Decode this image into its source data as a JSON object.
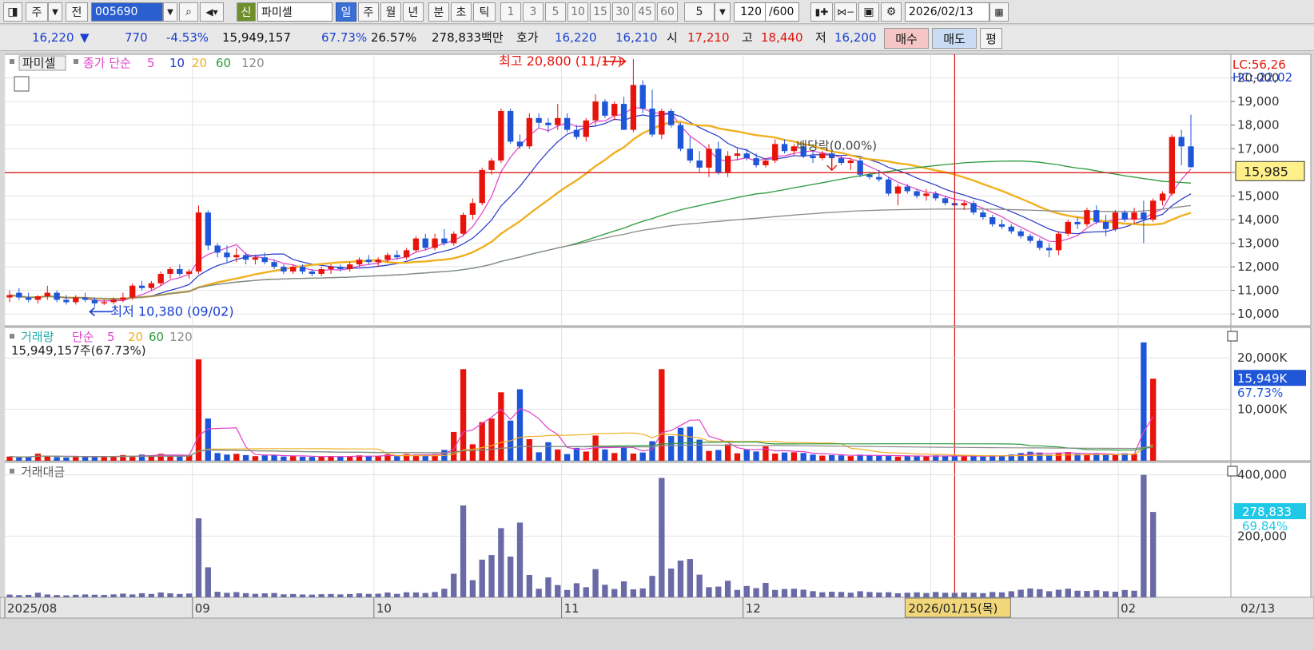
{
  "toolbar": {
    "type_label": "주",
    "prev_label": "전",
    "code": "005690",
    "stock_name": "파미셀",
    "new_label": "신",
    "periods": [
      "일",
      "주",
      "월",
      "년"
    ],
    "period_selected": "일",
    "intraday": [
      "분",
      "초",
      "틱"
    ],
    "minutes": [
      "1",
      "3",
      "5",
      "10",
      "15",
      "30",
      "45",
      "60"
    ],
    "custom_minute": "5",
    "bar_count": "120",
    "bar_total": "/600",
    "date": "2026/02/13"
  },
  "quote": {
    "price": "16,220",
    "arrow": "▼",
    "change": "770",
    "change_pct": "-4.53%",
    "volume": "15,949,157",
    "vol_ratio": "67.73%",
    "turnover_ratio": "26.57%",
    "amount": "278,833백만",
    "ask_label": "호가",
    "ask": "16,220",
    "bid": "16,210",
    "open_label": "시",
    "open": "17,210",
    "high_label": "고",
    "high": "18,440",
    "low_label": "저",
    "low": "16,200",
    "buy_label": "매수",
    "sell_label": "매도",
    "eval_label": "평"
  },
  "colors": {
    "up": "#e8140c",
    "down": "#1f56d8",
    "ma5": "#e040c8",
    "ma10": "#2636c8",
    "ma20": "#f0b020",
    "ma60": "#2a9a3c",
    "ma120": "#8a8a8a",
    "amount_bar": "#6a6aa6",
    "crosshair": "#d11"
  },
  "chart_data": [
    {
      "type": "candlestick",
      "title": "파미셀",
      "series_label": "종가 단순",
      "ma_periods": [
        "5",
        "10",
        "20",
        "60",
        "120"
      ],
      "y_ticks": [
        "20,000",
        "19,000",
        "18,000",
        "17,000",
        "16,000",
        "15,000",
        "14,000",
        "13,000",
        "12,000",
        "11,000",
        "10,000"
      ],
      "ylim": [
        9500,
        21000
      ],
      "x_labels": [
        "2025/08",
        "09",
        "10",
        "11",
        "12",
        "2026/0",
        "02"
      ],
      "x_label_dates": [
        "2025-08-01",
        "2025-09-01",
        "2025-10-01",
        "2025-11-01",
        "2025-12-01",
        "2026-01-01",
        "2026-02-01"
      ],
      "annotations": {
        "high": "최고 20,800 (11/17)",
        "low": "최저 10,380 (09/02)",
        "dividend": "배당락(0.00%)",
        "lc": "LC:56,26",
        "hc": "HC:-22,02",
        "cursor_price": "15,985",
        "cursor_date": "2026/01/15(목)"
      },
      "ohlc": [
        [
          10700,
          11000,
          10500,
          10800
        ],
        [
          10900,
          11100,
          10600,
          10700
        ],
        [
          10700,
          10900,
          10500,
          10600
        ],
        [
          10600,
          10800,
          10450,
          10750
        ],
        [
          10750,
          11200,
          10600,
          10900
        ],
        [
          10900,
          11000,
          10500,
          10600
        ],
        [
          10600,
          10800,
          10400,
          10500
        ],
        [
          10500,
          10800,
          10400,
          10700
        ],
        [
          10700,
          10900,
          10500,
          10600
        ],
        [
          10600,
          10700,
          10300,
          10450
        ],
        [
          10450,
          10600,
          10380,
          10500
        ],
        [
          10500,
          10700,
          10400,
          10600
        ],
        [
          10600,
          10900,
          10500,
          10700
        ],
        [
          10700,
          11300,
          10600,
          11200
        ],
        [
          11200,
          11400,
          11000,
          11100
        ],
        [
          11100,
          11400,
          11000,
          11300
        ],
        [
          11300,
          11800,
          11200,
          11700
        ],
        [
          11700,
          12000,
          11500,
          11900
        ],
        [
          11900,
          12100,
          11600,
          11700
        ],
        [
          11700,
          11900,
          11500,
          11800
        ],
        [
          11800,
          14600,
          11700,
          14300
        ],
        [
          14300,
          14400,
          12700,
          12900
        ],
        [
          12900,
          13000,
          12400,
          12600
        ],
        [
          12600,
          12900,
          12200,
          12400
        ],
        [
          12400,
          12800,
          12200,
          12500
        ],
        [
          12500,
          12600,
          12100,
          12300
        ],
        [
          12300,
          12500,
          12100,
          12400
        ],
        [
          12400,
          12600,
          12100,
          12200
        ],
        [
          12200,
          12300,
          11900,
          12000
        ],
        [
          12000,
          12100,
          11700,
          11800
        ],
        [
          11800,
          12100,
          11700,
          12000
        ],
        [
          12000,
          12100,
          11700,
          11800
        ],
        [
          11800,
          11900,
          11600,
          11700
        ],
        [
          11700,
          12000,
          11600,
          11900
        ],
        [
          11900,
          12100,
          11700,
          12000
        ],
        [
          12000,
          12100,
          11800,
          11900
        ],
        [
          11900,
          12200,
          11800,
          12100
        ],
        [
          12100,
          12400,
          12000,
          12300
        ],
        [
          12300,
          12500,
          12100,
          12200
        ],
        [
          12200,
          12400,
          12000,
          12300
        ],
        [
          12300,
          12600,
          12200,
          12500
        ],
        [
          12500,
          12700,
          12300,
          12400
        ],
        [
          12400,
          12800,
          12300,
          12700
        ],
        [
          12700,
          13300,
          12600,
          13200
        ],
        [
          13200,
          13400,
          12700,
          12800
        ],
        [
          12800,
          13400,
          12700,
          13200
        ],
        [
          13200,
          13600,
          12900,
          13000
        ],
        [
          13000,
          13500,
          12900,
          13400
        ],
        [
          13400,
          14300,
          13300,
          14200
        ],
        [
          14200,
          14900,
          14000,
          14700
        ],
        [
          14700,
          16200,
          14600,
          16100
        ],
        [
          16100,
          16600,
          15900,
          16500
        ],
        [
          16500,
          18700,
          16400,
          18600
        ],
        [
          18600,
          18700,
          17200,
          17300
        ],
        [
          17300,
          17600,
          17000,
          17100
        ],
        [
          17100,
          18500,
          17000,
          18300
        ],
        [
          18300,
          18500,
          17900,
          18100
        ],
        [
          18100,
          18300,
          17700,
          18000
        ],
        [
          18000,
          18900,
          17800,
          18300
        ],
        [
          18300,
          18500,
          17700,
          17800
        ],
        [
          17800,
          18000,
          17400,
          17500
        ],
        [
          17500,
          18300,
          17300,
          18200
        ],
        [
          18200,
          19300,
          18000,
          19000
        ],
        [
          19000,
          19100,
          18300,
          18400
        ],
        [
          18400,
          19000,
          18200,
          18900
        ],
        [
          18900,
          19200,
          17800,
          17800
        ],
        [
          17800,
          20800,
          17700,
          19700
        ],
        [
          19700,
          19900,
          18500,
          18700
        ],
        [
          18700,
          19500,
          17500,
          17600
        ],
        [
          17600,
          18700,
          17400,
          18600
        ],
        [
          18600,
          18700,
          17900,
          18000
        ],
        [
          18000,
          18100,
          16900,
          17000
        ],
        [
          17000,
          17500,
          16400,
          16500
        ],
        [
          16500,
          16900,
          16000,
          16200
        ],
        [
          16200,
          17200,
          15800,
          17000
        ],
        [
          17000,
          17300,
          15900,
          16000
        ],
        [
          16000,
          16900,
          15800,
          16700
        ],
        [
          16700,
          17000,
          16500,
          16800
        ],
        [
          16800,
          17000,
          16500,
          16600
        ],
        [
          16600,
          16800,
          16200,
          16300
        ],
        [
          16300,
          16600,
          16200,
          16500
        ],
        [
          16500,
          17400,
          16400,
          17200
        ],
        [
          17200,
          17400,
          16800,
          16900
        ],
        [
          16900,
          17200,
          16700,
          17100
        ],
        [
          17100,
          17300,
          16600,
          16700
        ],
        [
          16700,
          16900,
          16400,
          16600
        ],
        [
          16600,
          16900,
          16500,
          16800
        ],
        [
          16800,
          16900,
          16500,
          16600
        ],
        [
          16600,
          16700,
          16300,
          16400
        ],
        [
          16400,
          16600,
          16100,
          16500
        ],
        [
          16500,
          16600,
          15800,
          15900
        ],
        [
          15900,
          16000,
          15700,
          15800
        ],
        [
          15800,
          16100,
          15600,
          15700
        ],
        [
          15700,
          15800,
          15000,
          15100
        ],
        [
          15100,
          15500,
          14600,
          15400
        ],
        [
          15400,
          15500,
          15100,
          15200
        ],
        [
          15200,
          15300,
          14900,
          15000
        ],
        [
          15000,
          15300,
          14800,
          15100
        ],
        [
          15100,
          15200,
          14800,
          14900
        ],
        [
          14900,
          15000,
          14600,
          14700
        ],
        [
          14700,
          14900,
          14500,
          14600
        ],
        [
          14600,
          14800,
          14400,
          14700
        ],
        [
          14700,
          14800,
          14200,
          14300
        ],
        [
          14300,
          14400,
          14000,
          14100
        ],
        [
          14100,
          14200,
          13700,
          13800
        ],
        [
          13800,
          14000,
          13600,
          13700
        ],
        [
          13700,
          13800,
          13400,
          13500
        ],
        [
          13500,
          13600,
          13200,
          13300
        ],
        [
          13300,
          13400,
          13000,
          13100
        ],
        [
          13100,
          13200,
          12700,
          12800
        ],
        [
          12800,
          13000,
          12400,
          12700
        ],
        [
          12700,
          13500,
          12500,
          13400
        ],
        [
          13400,
          14000,
          13300,
          13900
        ],
        [
          13900,
          14100,
          13600,
          13800
        ],
        [
          13800,
          14500,
          13700,
          14400
        ],
        [
          14400,
          14600,
          13800,
          13900
        ],
        [
          13900,
          14200,
          13300,
          13600
        ],
        [
          13600,
          14400,
          13500,
          14300
        ],
        [
          14300,
          14400,
          13900,
          14000
        ],
        [
          14000,
          14500,
          13800,
          14300
        ],
        [
          14300,
          14800,
          13000,
          14000
        ],
        [
          14000,
          14900,
          13900,
          14800
        ],
        [
          14800,
          15200,
          14600,
          15100
        ],
        [
          15100,
          17600,
          15000,
          17500
        ],
        [
          17500,
          17800,
          16300,
          17100
        ],
        [
          17100,
          18440,
          16200,
          16220
        ]
      ],
      "volume_axis": [
        "20,000K",
        "15,949K",
        "67.73%",
        "10,000K"
      ],
      "volume_label": "거래량",
      "volume_info": "15,949,157주(67.73%)",
      "volume_ma_periods": [
        "5",
        "20",
        "60",
        "120"
      ],
      "volumes_k": [
        820,
        640,
        760,
        1380,
        900,
        720,
        620,
        780,
        880,
        820,
        760,
        900,
        1100,
        860,
        1200,
        980,
        1350,
        1100,
        900,
        1050,
        19700,
        8200,
        1500,
        1200,
        1350,
        1100,
        900,
        1050,
        1150,
        820,
        900,
        780,
        750,
        850,
        900,
        800,
        880,
        1050,
        900,
        950,
        1250,
        900,
        1300,
        1200,
        1100,
        1300,
        2100,
        5600,
        17800,
        3200,
        7500,
        8200,
        13300,
        7800,
        13900,
        4200,
        1650,
        3600,
        2200,
        1300,
        2500,
        1800,
        4900,
        2200,
        1500,
        2800,
        1400,
        1600,
        3800,
        17800,
        4800,
        6400,
        6600,
        4100,
        1900,
        2100,
        3200,
        1450,
        2200,
        1800,
        2800,
        1400,
        1600,
        1650,
        1500,
        1200,
        1000,
        1100,
        1050,
        900,
        1200,
        1050,
        950,
        1000,
        800,
        900,
        980,
        850,
        1050,
        900,
        880,
        950,
        900,
        820,
        1050,
        980,
        1200,
        1500,
        1750,
        1600,
        1200,
        1500,
        1700,
        1300,
        1250,
        1400,
        1200,
        1100,
        1450,
        1300,
        23000,
        15949
      ],
      "amount_label": "거래대금",
      "amount_axis": [
        "400,000",
        "278,833",
        "69.84%",
        "200,000"
      ],
      "amounts": [
        8800,
        7200,
        8100,
        15000,
        9300,
        7500,
        6500,
        8300,
        9400,
        8600,
        8000,
        9600,
        12000,
        9400,
        13300,
        11000,
        15800,
        13000,
        10700,
        12400,
        258000,
        98000,
        18000,
        14600,
        16900,
        13500,
        11200,
        13000,
        14000,
        9700,
        10800,
        9200,
        8800,
        10100,
        10800,
        9500,
        10700,
        13000,
        11000,
        11700,
        15600,
        11200,
        16500,
        15900,
        14100,
        17200,
        28000,
        77000,
        300000,
        56000,
        123000,
        138000,
        226000,
        133000,
        244000,
        73000,
        28000,
        65000,
        40000,
        24000,
        46000,
        33000,
        92000,
        41000,
        27000,
        52000,
        26000,
        29000,
        70000,
        390000,
        94000,
        120000,
        125000,
        74000,
        33000,
        35000,
        54000,
        24000,
        37000,
        30000,
        47000,
        24000,
        27000,
        28000,
        25000,
        20000,
        16500,
        18200,
        17500,
        15000,
        19800,
        17300,
        15700,
        16500,
        13200,
        14900,
        16200,
        14000,
        17300,
        14800,
        14500,
        15700,
        14900,
        13500,
        17300,
        16200,
        19800,
        24800,
        28900,
        26400,
        19800,
        24800,
        28100,
        21500,
        20600,
        23100,
        19800,
        18200,
        23900,
        21500,
        400000,
        278833
      ],
      "amount_ylim": [
        0,
        420000
      ],
      "cursor_index": 100,
      "last_date": "02/13"
    }
  ]
}
